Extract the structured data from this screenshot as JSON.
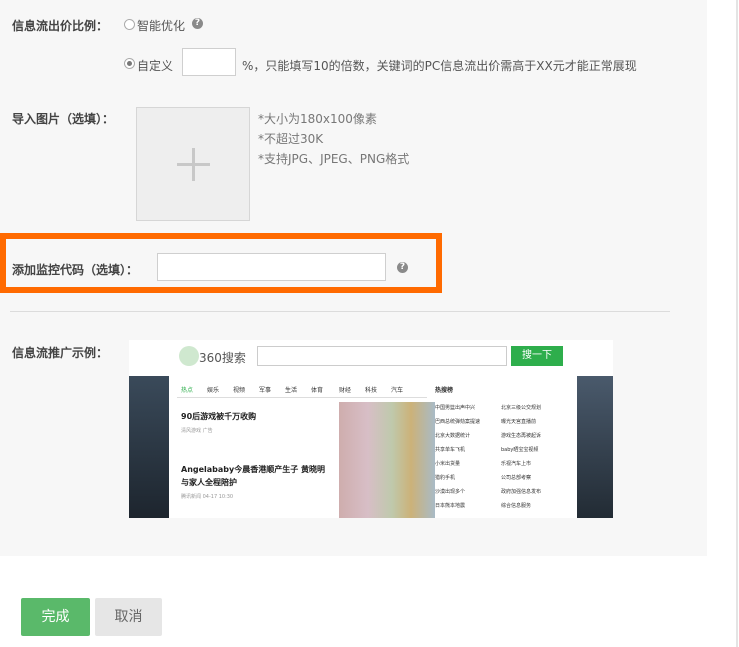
{
  "ratio": {
    "label": "信息流出价比例：",
    "option_smart": "智能优化",
    "option_custom": "自定义",
    "custom_value": "",
    "unit_hint": "%，只能填写10的倍数，关键词的PC信息流出价需高于XX元才能正常展现"
  },
  "image": {
    "label": "导入图片（选填）：",
    "hints": [
      "*大小为180x100像素",
      "*不超过30K",
      "*支持JPG、JPEG、PNG格式"
    ]
  },
  "monitor": {
    "label": "添加监控代码（选填）：",
    "value": ""
  },
  "example": {
    "label": "信息流推广示例：",
    "brand": "360搜索",
    "search_button": "搜一下",
    "nav": [
      "热点",
      "娱乐",
      "视频",
      "军事",
      "生活",
      "体育",
      "财经",
      "科技",
      "汽车"
    ],
    "hot_title": "热搜榜",
    "news": [
      {
        "title": "90后游戏被千万收购",
        "meta": "清风游戏  广告"
      },
      {
        "title": "Angelababy今晨香港顺产生子 黄晓明",
        "title2": "与家人全程陪护",
        "meta": "腾讯新闻  04-17 10:30"
      }
    ],
    "hot_links_left": [
      "中国男篮出声中兴",
      "巴西总统弹劾案提速",
      "北京大数据统计",
      "共享单车飞机",
      "小米出货量",
      "猎豹手机",
      "沙漠出现多个",
      "日本熊本地震"
    ],
    "hot_links_right": [
      "北京三级公交规划",
      "曝光天宫直播前",
      "游戏生态再被起诉",
      "baby晒宝宝视频",
      "乐视汽车上市",
      "公司总部考察",
      "政府加强信息发布",
      "综合信息服务"
    ]
  },
  "actions": {
    "ok": "完成",
    "cancel": "取消"
  },
  "colors": {
    "highlight": "#ff6a00",
    "primary_green": "#5ab96a"
  }
}
